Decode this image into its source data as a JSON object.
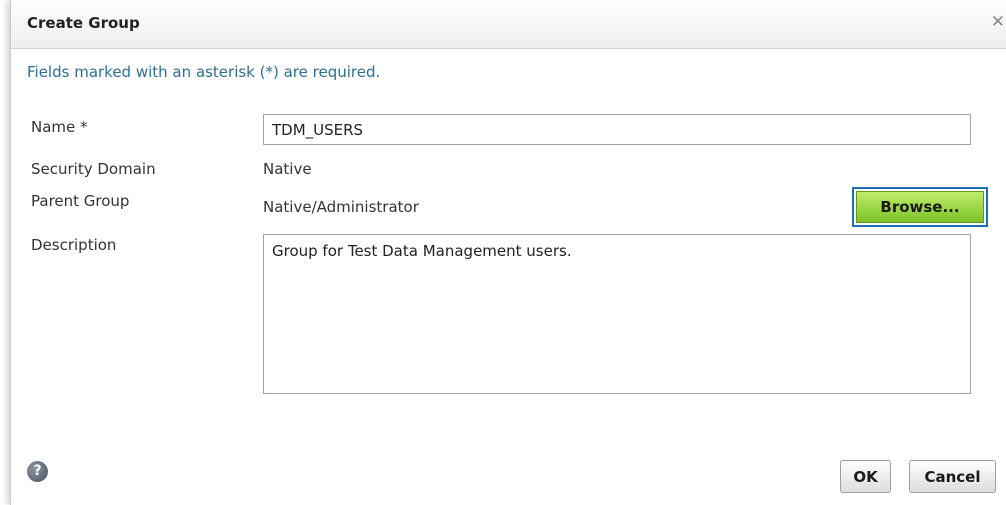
{
  "dialog": {
    "title": "Create Group",
    "close_icon": "close-icon"
  },
  "notice": "Fields marked with an asterisk (*) are required.",
  "form": {
    "name_label": "Name *",
    "name_value": "TDM_USERS",
    "security_domain_label": "Security Domain",
    "security_domain_value": "Native",
    "parent_group_label": "Parent Group",
    "parent_group_value": "Native/Administrator",
    "browse_label": "Browse...",
    "description_label": "Description",
    "description_value": "Group for Test Data Management users."
  },
  "footer": {
    "help_icon": "help-icon",
    "ok_label": "OK",
    "cancel_label": "Cancel"
  },
  "colors": {
    "notice_text": "#2d6f91",
    "browse_button": "#8ed23a",
    "browse_focus_ring": "#1d6fb8"
  }
}
